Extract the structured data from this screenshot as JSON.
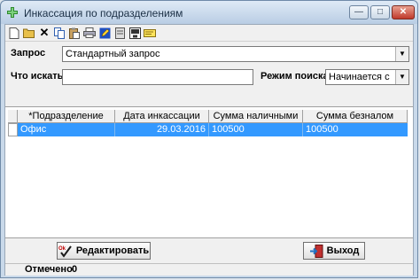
{
  "window": {
    "title": "Инкассация по подразделениям"
  },
  "filter": {
    "query_label": "Запрос",
    "query_value": "Стандартный запрос",
    "search_label": "Что искать",
    "search_value": "",
    "mode_label": "Режим поиска",
    "mode_value": "Начинается с"
  },
  "grid": {
    "columns": [
      "*Подразделение",
      "Дата инкассации",
      "Сумма наличными",
      "Сумма безналом"
    ],
    "rows": [
      [
        "Офис",
        "29.03.2016",
        "100500",
        "100500"
      ]
    ]
  },
  "buttons": {
    "edit": "Редактировать",
    "exit": "Выход",
    "edit_badge": "Ok"
  },
  "status": {
    "label": "Отмечено",
    "count": "0"
  },
  "colors": {
    "selection": "#3399ff",
    "accent_icon": "#2e8b2e"
  }
}
